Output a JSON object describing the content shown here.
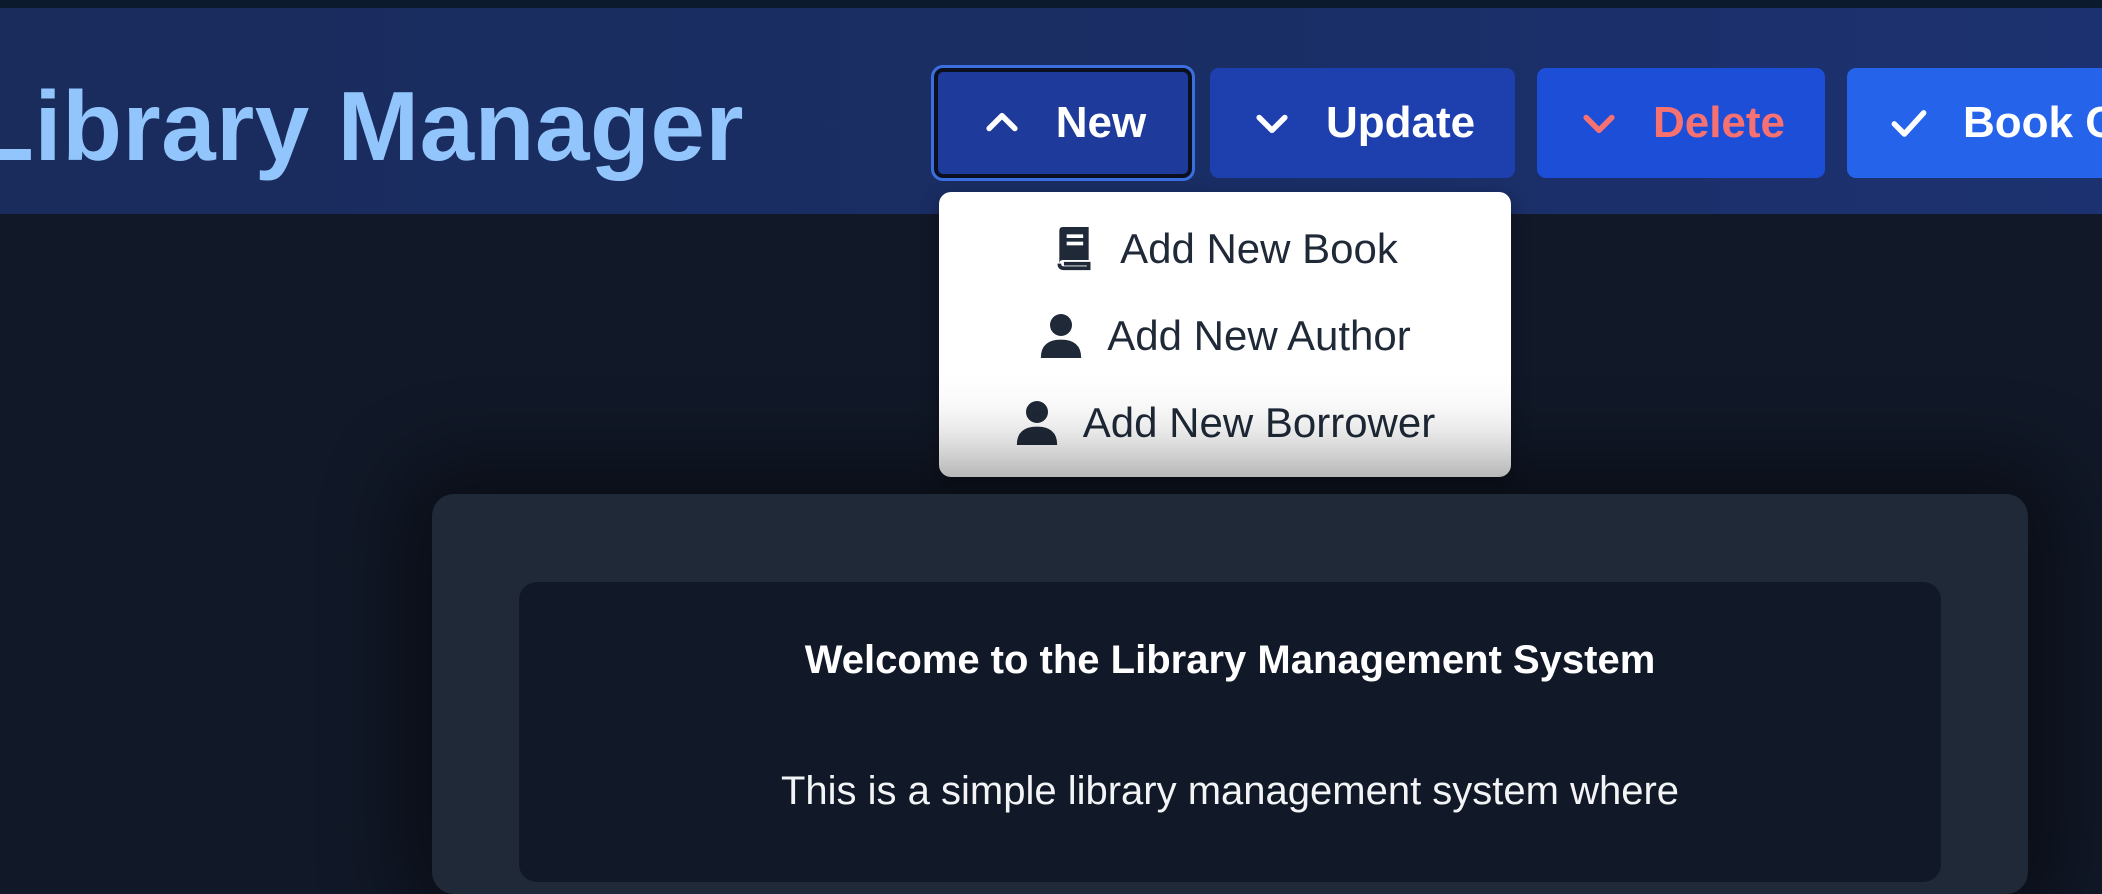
{
  "header": {
    "title": "Library Manager"
  },
  "toolbar": {
    "new_label": "New",
    "update_label": "Update",
    "delete_label": "Delete",
    "book_label": "Book C"
  },
  "new_menu": {
    "items": [
      {
        "label": "Add New Book",
        "icon": "book-icon"
      },
      {
        "label": "Add New Author",
        "icon": "user-icon"
      },
      {
        "label": "Add New Borrower",
        "icon": "user-icon"
      }
    ]
  },
  "main": {
    "heading": "Welcome to the Library Management System",
    "intro": "This is a simple library management system where"
  },
  "colors": {
    "title": "#93c5fd",
    "delete_text": "#f87171",
    "page_bg": "#111827"
  }
}
